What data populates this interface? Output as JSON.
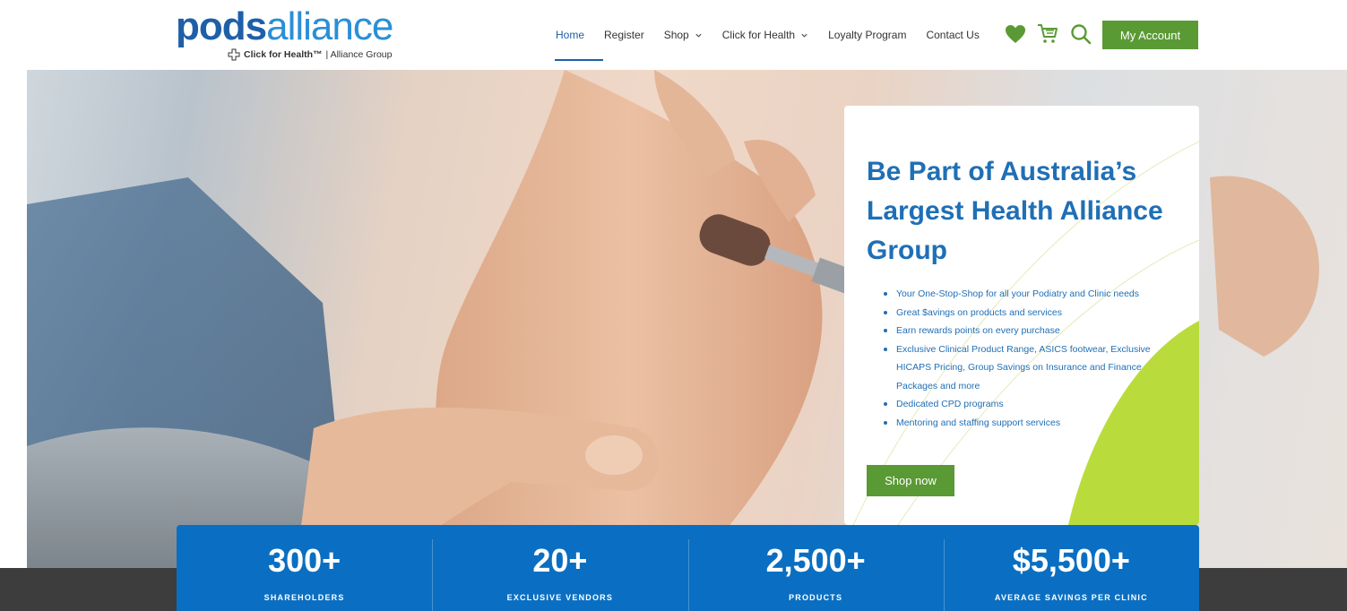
{
  "header": {
    "logo": {
      "word_bold": "pods",
      "word_light": "alliance",
      "sub_brand": "Click for Health™",
      "sub_text": "| Alliance Group"
    },
    "nav": [
      {
        "label": "Home",
        "active": true,
        "dropdown": false
      },
      {
        "label": "Register",
        "active": false,
        "dropdown": false
      },
      {
        "label": "Shop",
        "active": false,
        "dropdown": true
      },
      {
        "label": "Click for Health",
        "active": false,
        "dropdown": true
      },
      {
        "label": "Loyalty Program",
        "active": false,
        "dropdown": false
      },
      {
        "label": "Contact Us",
        "active": false,
        "dropdown": false
      }
    ],
    "icons": [
      "heart-icon",
      "cart-icon",
      "search-icon"
    ],
    "account_label": "My Account"
  },
  "hero": {
    "title": "Be Part of Australia’s Largest Health Alliance Group",
    "bullets": [
      "Your One-Stop-Shop for all your Podiatry and Clinic needs",
      "Great $avings on products and services",
      "Earn rewards points on every purchase",
      "Exclusive Clinical Product Range, ASICS footwear, Exclusive HICAPS Pricing, Group Savings on Insurance and Finance Packages and more",
      "Dedicated CPD programs",
      "Mentoring and staffing support services"
    ],
    "cta_label": "Shop now"
  },
  "stats": [
    {
      "value": "300+",
      "label": "SHAREHOLDERS"
    },
    {
      "value": "20+",
      "label": "EXCLUSIVE VENDORS"
    },
    {
      "value": "2,500+",
      "label": "PRODUCTS"
    },
    {
      "value": "$5,500+",
      "label": "AVERAGE SAVINGS PER CLINIC"
    }
  ],
  "colors": {
    "brand_blue": "#1f5fa8",
    "accent_green": "#5a9a35",
    "lime": "#b9dc3c",
    "stats_blue": "#0a6fc2"
  }
}
